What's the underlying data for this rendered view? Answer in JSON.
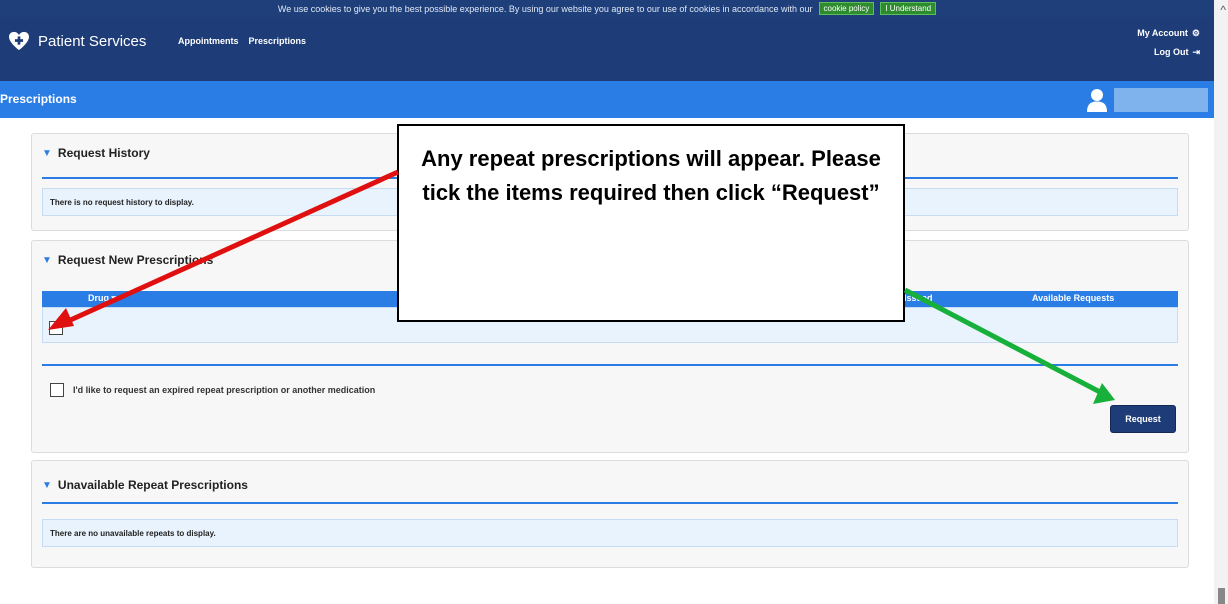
{
  "cookie": {
    "message": "We use cookies to give you the best possible experience. By using our website you agree to our use of cookies in accordance with our",
    "policy_label": "cookie policy",
    "accept_label": "I Understand"
  },
  "header": {
    "app_name": "Patient Services",
    "nav": [
      "Appointments",
      "Prescriptions"
    ],
    "my_account": "My Account",
    "my_account_icon": "gear-icon",
    "log_out": "Log Out",
    "log_out_icon": "logout-icon"
  },
  "page": {
    "title": "Prescriptions"
  },
  "request_history": {
    "title": "Request History",
    "empty_text": "There is no request history to display."
  },
  "request_new": {
    "title": "Request New Prescriptions",
    "columns": [
      "Drug",
      "Issued",
      "Available Requests"
    ],
    "expired_label": "I'd like to request an expired repeat prescription or another medication",
    "request_button": "Request"
  },
  "unavailable": {
    "title": "Unavailable Repeat Prescriptions",
    "empty_text": "There are no unavailable repeats to display."
  },
  "callout": {
    "text": "Any repeat prescriptions will appear. Please tick the items required then click “Request”"
  },
  "colors": {
    "header": "#1e3c78",
    "accent": "#2b7de6",
    "cookie_button": "#2e8b2e",
    "red_arrow": "#e01010",
    "green_arrow": "#16b03a"
  }
}
